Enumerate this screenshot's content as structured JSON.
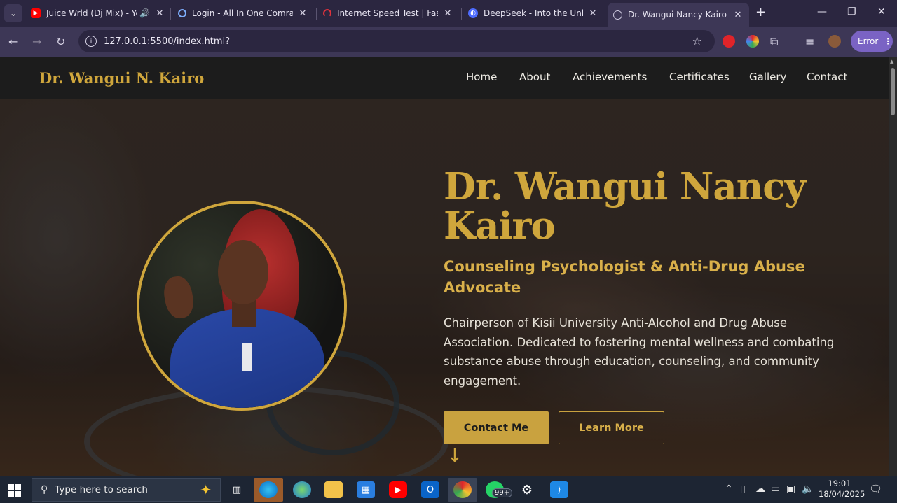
{
  "browser": {
    "tabs": [
      {
        "label": "Juice Wrld (Dj Mix) - You",
        "favicon": "youtube-icon",
        "audio": true
      },
      {
        "label": "Login - All In One Comrade",
        "favicon": "loading-icon"
      },
      {
        "label": "Internet Speed Test | Fast.co",
        "favicon": "fast-icon"
      },
      {
        "label": "DeepSeek - Into the Unknow",
        "favicon": "deepseek-icon"
      },
      {
        "label": "Dr. Wangui Nancy Kairo | Co",
        "favicon": "globe-icon",
        "active": true
      }
    ],
    "new_tab": "+",
    "url": "127.0.0.1:5500/index.html?",
    "profile_status": "Error"
  },
  "site": {
    "brand": "Dr. Wangui N. Kairo",
    "nav": [
      "Home",
      "About",
      "Achievements",
      "Certificates",
      "Gallery",
      "Contact"
    ],
    "hero": {
      "title": "Dr. Wangui Nancy Kairo",
      "subtitle": "Counseling Psychologist & Anti-Drug Abuse Advocate",
      "description": "Chairperson of Kisii University Anti-Alcohol and Drug Abuse Association. Dedicated to fostering mental wellness and combating substance abuse through education, counseling, and community engagement.",
      "primary_button": "Contact Me",
      "secondary_button": "Learn More"
    }
  },
  "taskbar": {
    "search_placeholder": "Type here to search",
    "whatsapp_badge": "99+",
    "time": "19:01",
    "date": "18/04/2025"
  },
  "colors": {
    "accent_gold": "#cfa63c",
    "navbar": "#1c1c1c",
    "browser_frame": "#2b2640",
    "error_pill": "#7a63c4"
  }
}
